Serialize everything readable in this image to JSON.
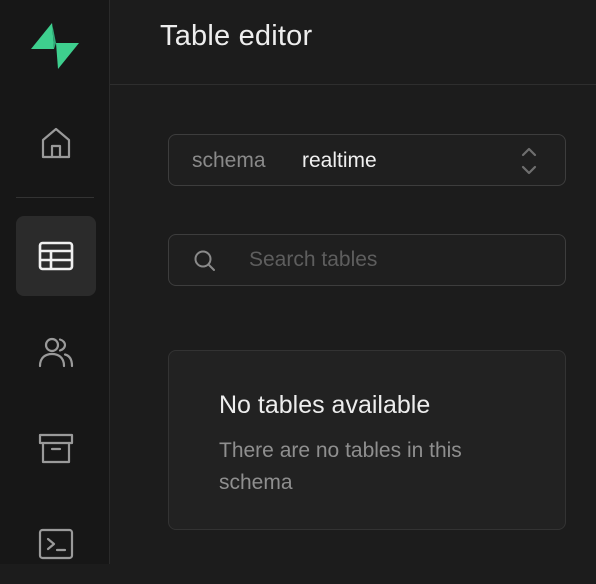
{
  "colors": {
    "brand": "#3ecf8e",
    "rail_bg": "#171717",
    "main_bg": "#1c1c1c",
    "icon": "#9a9a9a",
    "muted_text": "#8f8f8f"
  },
  "nav": {
    "items": [
      {
        "icon": "home-icon",
        "active": false
      },
      {
        "icon": "table-icon",
        "active": true
      },
      {
        "icon": "users-icon",
        "active": false
      },
      {
        "icon": "archive-icon",
        "active": false
      },
      {
        "icon": "terminal-icon",
        "active": false
      }
    ]
  },
  "header": {
    "title": "Table editor"
  },
  "schema": {
    "label": "schema",
    "value": "realtime"
  },
  "search": {
    "placeholder": "Search tables",
    "value": ""
  },
  "empty_state": {
    "title": "No tables available",
    "description": "There are no tables in this schema"
  }
}
